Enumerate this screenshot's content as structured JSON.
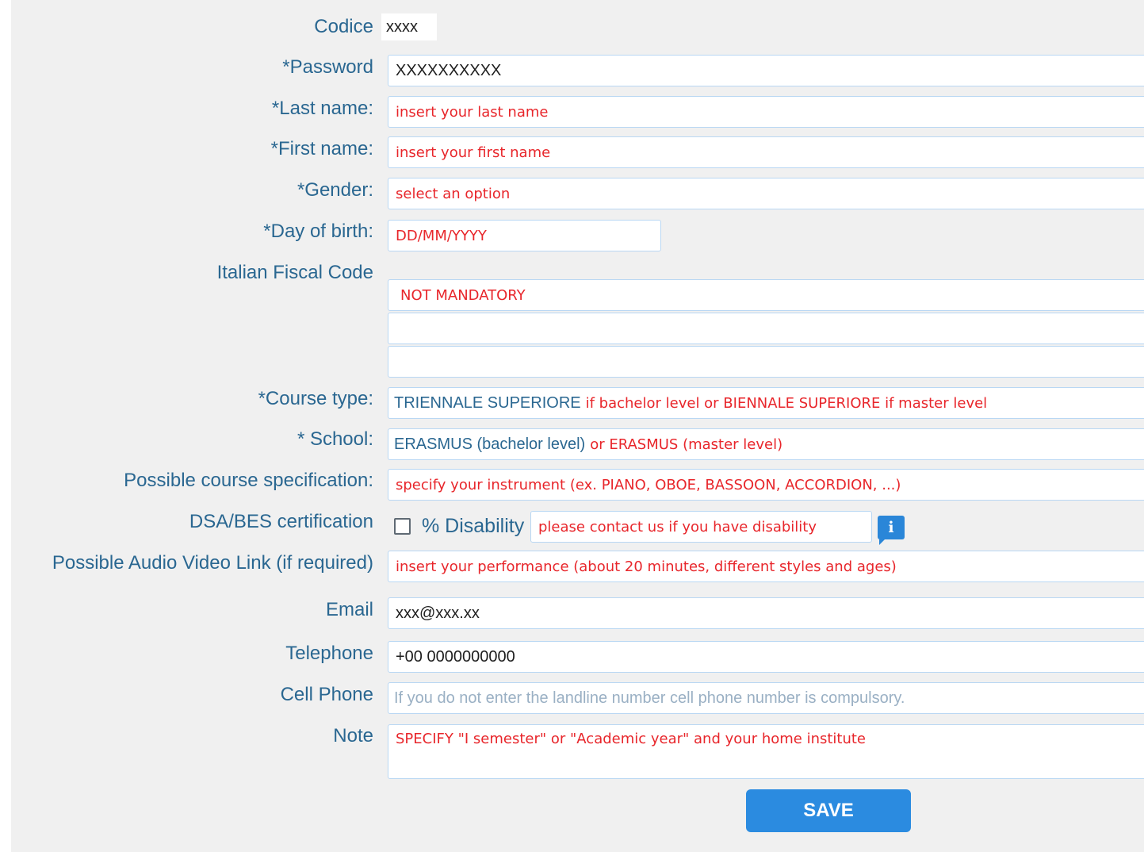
{
  "form": {
    "codice": {
      "label": "Codice",
      "value": "xxxx"
    },
    "password": {
      "label": "*Password",
      "value": "XXXXXXXXXX"
    },
    "last_name": {
      "label": "*Last name:",
      "value": "insert your last name"
    },
    "first_name": {
      "label": "*First name:",
      "value": "insert your first name"
    },
    "gender": {
      "label": "*Gender:",
      "value": "select an option"
    },
    "birth": {
      "label": "*Day of birth:",
      "value": "DD/MM/YYYY"
    },
    "fiscal": {
      "label": "Italian Fiscal Code",
      "value": "NOT MANDATORY"
    },
    "course_type": {
      "label": "*Course type:",
      "part1": "TRIENNALE SUPERIORE",
      "part2": "if bachelor level or BIENNALE SUPERIORE if master level"
    },
    "school": {
      "label": "* School:",
      "part1": "ERASMUS (bachelor level)",
      "part2": "or ERASMUS (master level)"
    },
    "specification": {
      "label": "Possible course specification:",
      "value": "specify your instrument (ex. PIANO, OBOE, BASSOON, ACCORDION, ...)"
    },
    "dsa": {
      "label": "DSA/BES certification",
      "checked": false,
      "disability_label": "% Disability",
      "disability_value": "please contact us if you have disability",
      "info_glyph": "i",
      "info_icon": "info-icon"
    },
    "av_link": {
      "label": "Possible Audio Video Link (if required)",
      "value": "insert your performance (about 20 minutes, different styles and ages)"
    },
    "email": {
      "label": "Email",
      "value": "xxx@xxx.xx"
    },
    "telephone": {
      "label": "Telephone",
      "value": "+00 0000000000"
    },
    "cell": {
      "label": "Cell Phone",
      "placeholder": "If you do not enter the landline  number cell phone number is compulsory."
    },
    "note": {
      "label": "Note",
      "value": "SPECIFY \"I semester\" or \"Academic year\" and your home institute"
    },
    "save_label": "SAVE"
  },
  "colors": {
    "label": "#2a6791",
    "placeholder_red": "#e8262b",
    "field_border": "#b9d7f3",
    "button": "#2b8be0",
    "panel_bg": "#f0f0f0"
  }
}
